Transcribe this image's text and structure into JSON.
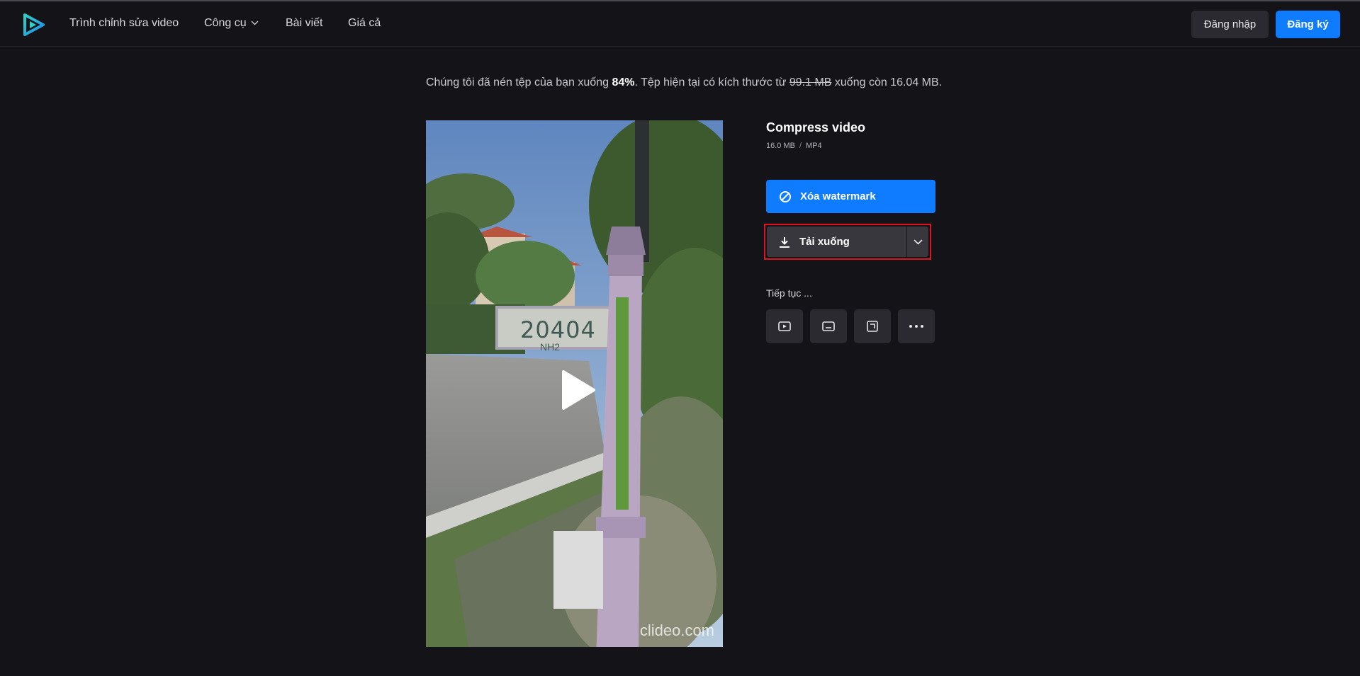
{
  "nav": {
    "items": [
      {
        "label": "Trình chỉnh sửa video"
      },
      {
        "label": "Công cụ"
      },
      {
        "label": "Bài viết"
      },
      {
        "label": "Giá cả"
      }
    ],
    "login_label": "Đăng nhập",
    "signup_label": "Đăng ký"
  },
  "summary": {
    "prefix": "Chúng tôi đã nén tệp của bạn xuống ",
    "percent": "84%",
    "middle": ". Tệp hiện tại có kích thước từ ",
    "old_size": "99.1 MB",
    "suffix": " xuống còn 16.04 MB."
  },
  "video": {
    "sign_number": "20404",
    "sign_sub": "NH2",
    "watermark": "clideo.com"
  },
  "panel": {
    "title": "Compress video",
    "size": "16.0 MB",
    "separator": "/",
    "format": "MP4",
    "remove_watermark_label": "Xóa watermark",
    "download_label": "Tải xuống",
    "continue_label": "Tiếp tục ..."
  },
  "colors": {
    "background": "#141318",
    "primary": "#0f7bff",
    "button_dark": "#38373e",
    "highlight": "#e0141e"
  },
  "icons": {
    "logo": "play-logo-icon",
    "remove": "prohibited-icon",
    "download": "download-icon",
    "tools": [
      "video-player-icon",
      "subtitles-icon",
      "crop-icon",
      "more-icon"
    ]
  }
}
